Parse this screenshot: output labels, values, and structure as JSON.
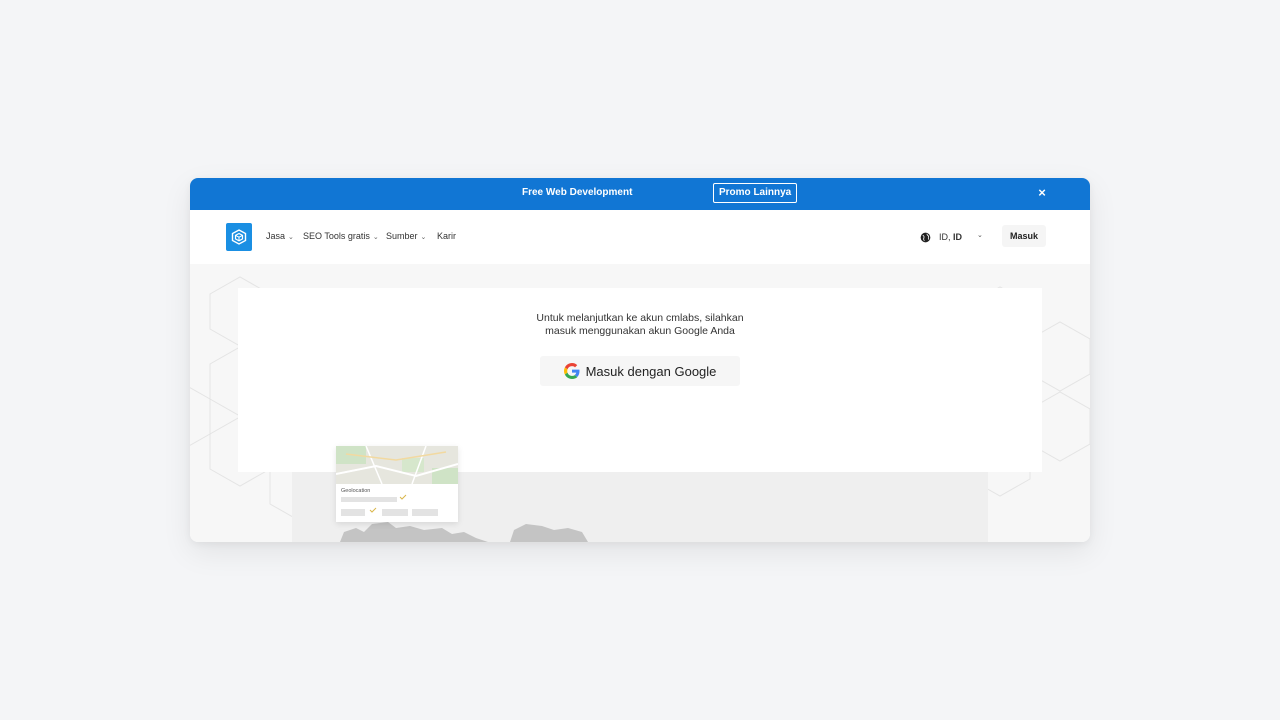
{
  "promo": {
    "text": "Free Web Development",
    "button_label": "Promo Lainnya",
    "close_symbol": "×"
  },
  "nav": {
    "logo_icon": "cube-logo-icon",
    "items": [
      {
        "label": "Jasa",
        "has_dropdown": true
      },
      {
        "label": "SEO Tools gratis",
        "has_dropdown": true
      },
      {
        "label": "Sumber",
        "has_dropdown": true
      },
      {
        "label": "Karir",
        "has_dropdown": false
      }
    ],
    "lang_prefix": "ID,",
    "lang_code": "ID",
    "login_label": "Masuk"
  },
  "login": {
    "message_line1": "Untuk melanjutkan ke akun cmlabs, silahkan",
    "message_line2": "masuk menggunakan akun Google Anda",
    "google_button_label": "Masuk dengan Google"
  },
  "preview": {
    "card_title": "Geolocation"
  },
  "colors": {
    "brand_blue": "#1176d4",
    "logo_blue": "#1a8fe3",
    "page_bg": "#f4f5f7"
  }
}
